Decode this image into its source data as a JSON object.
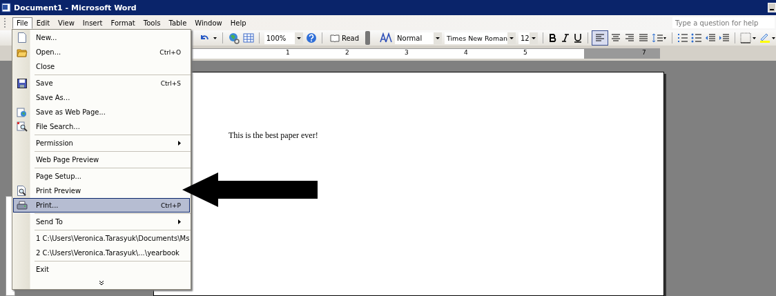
{
  "window": {
    "title": "Document1 - Microsoft Word"
  },
  "menu_bar": [
    {
      "label": "File",
      "selected": true
    },
    {
      "label": "Edit",
      "selected": false
    },
    {
      "label": "View",
      "selected": false
    },
    {
      "label": "Insert",
      "selected": false
    },
    {
      "label": "Format",
      "selected": false
    },
    {
      "label": "Tools",
      "selected": false
    },
    {
      "label": "Table",
      "selected": false
    },
    {
      "label": "Window",
      "selected": false
    },
    {
      "label": "Help",
      "selected": false
    }
  ],
  "help_search": {
    "placeholder": "Type a question for help"
  },
  "toolbar": {
    "zoom": "100%",
    "read": "Read",
    "style": "Normal",
    "font": "Times New Roman",
    "size": "12",
    "align_left_on": true
  },
  "ruler": [
    "1",
    "2",
    "3",
    "4",
    "5",
    "7"
  ],
  "file_menu": [
    {
      "kind": "item",
      "label": "New...",
      "selected": false
    },
    {
      "kind": "item",
      "label": "Open...",
      "shortcut": "Ctrl+O",
      "selected": false
    },
    {
      "kind": "item",
      "label": "Close",
      "selected": false
    },
    {
      "kind": "separator"
    },
    {
      "kind": "item",
      "label": "Save",
      "shortcut": "Ctrl+S",
      "selected": false
    },
    {
      "kind": "item",
      "label": "Save As...",
      "selected": false
    },
    {
      "kind": "item",
      "label": "Save as Web Page...",
      "selected": false
    },
    {
      "kind": "item",
      "label": "File Search...",
      "selected": false
    },
    {
      "kind": "separator"
    },
    {
      "kind": "item",
      "label": "Permission",
      "submenu": true,
      "selected": false
    },
    {
      "kind": "separator"
    },
    {
      "kind": "item",
      "label": "Web Page Preview",
      "selected": false
    },
    {
      "kind": "separator"
    },
    {
      "kind": "item",
      "label": "Page Setup...",
      "selected": false
    },
    {
      "kind": "item",
      "label": "Print Preview",
      "selected": false
    },
    {
      "kind": "item",
      "label": "Print...",
      "shortcut": "Ctrl+P",
      "selected": true
    },
    {
      "kind": "separator"
    },
    {
      "kind": "item",
      "label": "Send To",
      "submenu": true,
      "selected": false
    },
    {
      "kind": "separator"
    },
    {
      "kind": "item",
      "label": "1 C:\\Users\\Veronica.Tarasyuk\\Documents\\Ms",
      "selected": false
    },
    {
      "kind": "item",
      "label": "2 C:\\Users\\Veronica.Tarasyuk\\...\\yearbook",
      "selected": false
    },
    {
      "kind": "separator"
    },
    {
      "kind": "item",
      "label": "Exit",
      "selected": false
    },
    {
      "kind": "expand"
    }
  ],
  "document": {
    "text": "This is the best paper ever!"
  }
}
